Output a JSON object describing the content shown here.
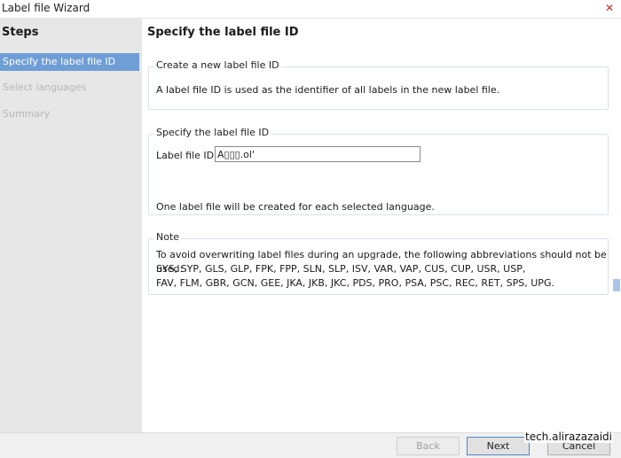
{
  "window": {
    "title": "Label file Wizard"
  },
  "sidebar": {
    "title": "Steps",
    "steps": [
      {
        "label": "Specify the label file ID",
        "state": "active"
      },
      {
        "label": "Select languages",
        "state": "disabled"
      },
      {
        "label": "Summary",
        "state": "disabled"
      }
    ]
  },
  "main": {
    "heading": "Specify the label file ID",
    "create_group": {
      "legend": "Create a new label file ID",
      "text": "A label file ID is used as the identifier of all labels in the new label file."
    },
    "specify_group": {
      "legend": "Specify the label file ID",
      "field_label": "Label file ID:",
      "field_value": "A▯▯▯.ol'",
      "info": "One label file will be created for each selected language."
    },
    "note_group": {
      "legend": "Note",
      "lines": [
        "To avoid overwriting label files during an upgrade, the following abbreviations should not be used:",
        "SYS, SYP, GLS, GLP, FPK, FPP, SLN, SLP, ISV, VAR, VAP, CUS, CUP, USR, USP,",
        "FAV, FLM, GBR, GCN, GEE, JKA, JKB, JKC, PDS, PRO, PSA, PSC, REC, RET, SPS, UPG."
      ]
    }
  },
  "buttons": {
    "back": "Back",
    "next": "Next",
    "cancel": "Cancel"
  },
  "watermark": "tech.alirazazaidi",
  "colors": {
    "accent": "#6f9ed6",
    "sidebar_bg": "#e7e7e7",
    "close": "#c42b1c"
  }
}
